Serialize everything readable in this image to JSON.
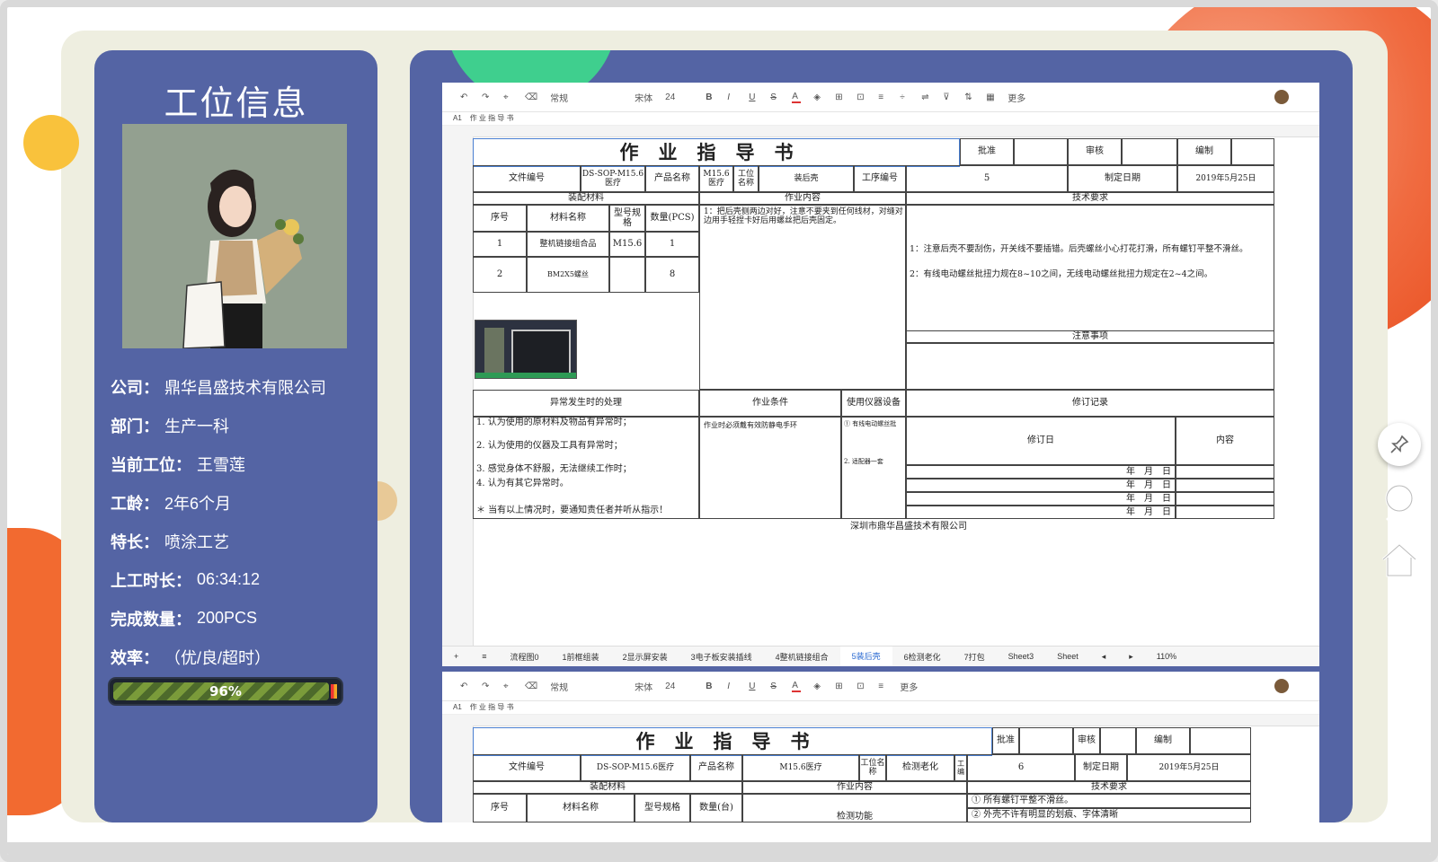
{
  "left": {
    "title": "工位信息",
    "info": [
      {
        "key": "公司：",
        "value": "鼎华昌盛技术有限公司"
      },
      {
        "key": "部门：",
        "value": "生产一科"
      },
      {
        "key": "当前工位：",
        "value": "王雪莲"
      },
      {
        "key": "工龄：",
        "value": "2年6个月"
      },
      {
        "key": "特长：",
        "value": "喷涂工艺"
      },
      {
        "key": "上工时长：",
        "value": "06:34:12"
      },
      {
        "key": "完成数量：",
        "value": "200PCS"
      },
      {
        "key": "效率：",
        "value": "（优/良/超时）"
      }
    ],
    "progress": {
      "label": "96%",
      "value": 0.96
    }
  },
  "sheet1": {
    "toolbar": [
      "常规",
      "宋体",
      "24",
      "更多"
    ],
    "cell_ref": "A1",
    "formula": "作 业 指 导 书",
    "title": "作业指导书",
    "approve": "批准",
    "review": "审核",
    "compile": "编制",
    "doc_no_label": "文件编号",
    "doc_no": "DS-SOP-M15.6医疗",
    "product_label": "产品名称",
    "product": "M15.6医疗",
    "station_label": "工位名称",
    "station": "装后壳",
    "process_label": "工序编号",
    "process": "5",
    "date_label": "制定日期",
    "date": "2019年5月25日",
    "materials": "装配材料",
    "content_head": "作业内容",
    "tech_head": "技术要求",
    "seq": "序号",
    "mat_name": "材料名称",
    "spec": "型号规格",
    "qty": "数量(PCS)",
    "row1": [
      "1",
      "整机链接组合品",
      "M15.6",
      "1"
    ],
    "row2": [
      "2",
      "BM2X5螺丝",
      "",
      "8"
    ],
    "content_text": "1：把后壳侧两边对好，注意不要夹到任何线材，对缝对边用手轻捏卡好后用螺丝把后壳固定。",
    "tech_text1": "1：注意后壳不要刮伤，开关线不要插错。后壳螺丝小心打花打滑，所有螺钉平整不滑丝。",
    "tech_text2": "2：有线电动螺丝批扭力规在8~10之间，无线电动螺丝批扭力规定在2~4之间。",
    "notes": "注意事项",
    "abnormal": "异常发生时的处理",
    "conditions": "作业条件",
    "instruments": "使用仪器设备",
    "revision": "修订记录",
    "rev_date": "修订日",
    "rev_content": "内容",
    "ab1": "1. 认为使用的原材料及物品有异常时；",
    "ab2": "2. 认为使用的仪器及工具有异常时；",
    "ab3": "3. 感觉身体不舒服，无法继续工作时；",
    "ab4": "4. 认为有其它异常时。",
    "ab5": "＊ 当有以上情况时，要通知责任者并听从指示！",
    "cond_text": "作业时必须戴有效防静电手环",
    "inst1": "① 有线电动螺丝批",
    "inst2": "2. 适配器一套",
    "ymd": "年　月　日",
    "company": "深圳市鼎华昌盛技术有限公司",
    "tabs": [
      "流程图0",
      "1前框组装",
      "2显示屏安装",
      "3电子板安装插线",
      "4整机链接组合",
      "5装后壳",
      "6检测老化",
      "7打包",
      "Sheet3",
      "Sheet"
    ],
    "active_tab": "5装后壳",
    "zoom": "110%"
  },
  "sheet2": {
    "title": "作业指导书",
    "approve": "批准",
    "review": "审核",
    "compile": "编制",
    "doc_no_label": "文件编号",
    "doc_no": "DS-SOP-M15.6医疗",
    "product_label": "产品名称",
    "product": "M15.6医疗",
    "station_label": "工位名称",
    "station": "检测老化",
    "process_label": "工编",
    "process": "6",
    "date_label": "制定日期",
    "date": "2019年5月25日",
    "materials": "装配材料",
    "content_head": "作业内容",
    "tech_head": "技术要求",
    "seq": "序号",
    "mat_name": "材料名称",
    "spec": "型号规格",
    "qty": "数量(台)",
    "content_text": "检测功能",
    "tech_text1": "① 所有螺钉平整不滑丝。",
    "tech_text2": "② 外壳不许有明显的划痕、字体清晰"
  },
  "colors": {
    "panel": "#5464a4",
    "shell": "#eeeee0",
    "accent": "#f06b40"
  }
}
